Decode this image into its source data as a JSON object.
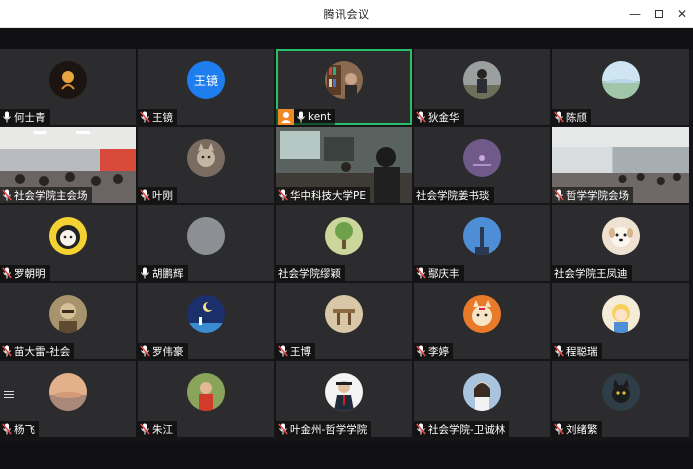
{
  "window": {
    "title": "腾讯会议",
    "minimize": "—",
    "close": "✕"
  },
  "colors": {
    "active_speaker_border": "#27c06a",
    "host_badge": "#f08a24",
    "muted_mic": "#e54848",
    "tile_bg": "#2c2c2e"
  },
  "participants": [
    {
      "name": "何士青",
      "mic": "on",
      "kind": "avatar",
      "avatar": "dark-heart"
    },
    {
      "name": "王镜",
      "mic": "muted",
      "kind": "avatar",
      "avatar": "text",
      "avatar_text": "王镜"
    },
    {
      "name": "kent",
      "mic": "on",
      "kind": "avatar",
      "avatar": "bookshelf",
      "host": true,
      "active": true
    },
    {
      "name": "狄金华",
      "mic": "muted",
      "kind": "avatar",
      "avatar": "person"
    },
    {
      "name": "陈颀",
      "mic": "muted",
      "kind": "avatar",
      "avatar": "landscape"
    },
    {
      "name": "社会学院主会场",
      "mic": "muted",
      "kind": "video",
      "video": "classroom"
    },
    {
      "name": "叶刚",
      "mic": "muted",
      "kind": "avatar",
      "avatar": "cat"
    },
    {
      "name": "华中科技大学PE",
      "mic": "muted",
      "kind": "video",
      "video": "office"
    },
    {
      "name": "社会学院姜书琰",
      "mic": "none",
      "kind": "avatar",
      "avatar": "purple"
    },
    {
      "name": "哲学学院会场",
      "mic": "muted",
      "kind": "video",
      "video": "hall"
    },
    {
      "name": "罗朝明",
      "mic": "muted",
      "kind": "avatar",
      "avatar": "cartoon-girl"
    },
    {
      "name": "胡鹏辉",
      "mic": "on",
      "kind": "avatar",
      "avatar": "grey"
    },
    {
      "name": "社会学院缪颖",
      "mic": "none",
      "kind": "avatar",
      "avatar": "tree"
    },
    {
      "name": "鄢庆丰",
      "mic": "muted",
      "kind": "avatar",
      "avatar": "tower"
    },
    {
      "name": "社会学院王凤迪",
      "mic": "none",
      "kind": "avatar",
      "avatar": "puppy"
    },
    {
      "name": "苗大雷-社会",
      "mic": "muted",
      "kind": "avatar",
      "avatar": "portrait"
    },
    {
      "name": "罗伟豪",
      "mic": "muted",
      "kind": "avatar",
      "avatar": "night-moon"
    },
    {
      "name": "王博",
      "mic": "muted",
      "kind": "avatar",
      "avatar": "wood"
    },
    {
      "name": "李婷",
      "mic": "muted",
      "kind": "avatar",
      "avatar": "tiger"
    },
    {
      "name": "程聪瑞",
      "mic": "muted",
      "kind": "avatar",
      "avatar": "alice"
    },
    {
      "name": "杨飞",
      "mic": "muted",
      "kind": "avatar",
      "avatar": "sunset"
    },
    {
      "name": "朱江",
      "mic": "muted",
      "kind": "avatar",
      "avatar": "kid"
    },
    {
      "name": "叶金州-哲学学院",
      "mic": "muted",
      "kind": "avatar",
      "avatar": "suit"
    },
    {
      "name": "社会学院-卫诚林",
      "mic": "muted",
      "kind": "avatar",
      "avatar": "girl-blue"
    },
    {
      "name": "刘绪繁",
      "mic": "muted",
      "kind": "avatar",
      "avatar": "dark-cat"
    }
  ]
}
